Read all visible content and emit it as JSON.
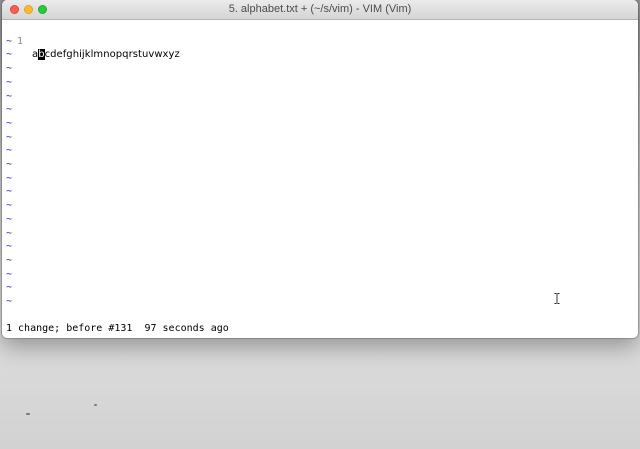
{
  "window": {
    "title": "5. alphabet.txt + (~/s/vim) - VIM (Vim)"
  },
  "buffer": {
    "lines": [
      {
        "number": "1",
        "before_cursor": "a",
        "cursor_char": "b",
        "after_cursor": "cdefghijklmnopqrstuvwxyz"
      }
    ],
    "empty_line_marker": "~",
    "empty_line_count": 20
  },
  "command_line": {
    "message": "1 change; before #131  97 seconds ago"
  },
  "colors": {
    "tilde": "#1f1fd0",
    "line_number": "#8d8d8d",
    "cursor_bg": "#000000"
  },
  "icons": {
    "pointer": "ibeam-cursor-icon"
  }
}
